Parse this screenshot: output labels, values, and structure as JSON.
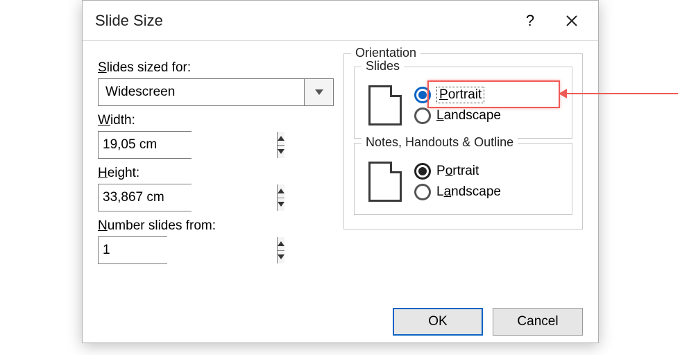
{
  "dialog": {
    "title": "Slide Size",
    "help_tooltip": "?",
    "close_tooltip": "Close"
  },
  "left": {
    "sized_for_label_pre": "S",
    "sized_for_label_post": "lides sized for:",
    "sized_for_value": "Widescreen",
    "width_label_pre": "W",
    "width_label_post": "idth:",
    "width_value": "19,05 cm",
    "height_label_pre": "H",
    "height_label_post": "eight:",
    "height_value": "33,867 cm",
    "number_label_pre": "N",
    "number_label_post": "umber slides from:",
    "number_value": "1"
  },
  "orientation": {
    "group_label": "Orientation",
    "slides": {
      "label": "Slides",
      "portrait_pre": "P",
      "portrait_post": "ortrait",
      "landscape_pre": "L",
      "landscape_post": "andscape",
      "selected": "portrait"
    },
    "notes": {
      "label": "Notes, Handouts & Outline",
      "portrait_pre": "o",
      "portrait_prefix": "P",
      "portrait_suffix": "rtrait",
      "landscape_pre": "a",
      "landscape_prefix": "L",
      "landscape_suffix": "ndscape",
      "selected": "portrait"
    }
  },
  "footer": {
    "ok": "OK",
    "cancel": "Cancel"
  }
}
